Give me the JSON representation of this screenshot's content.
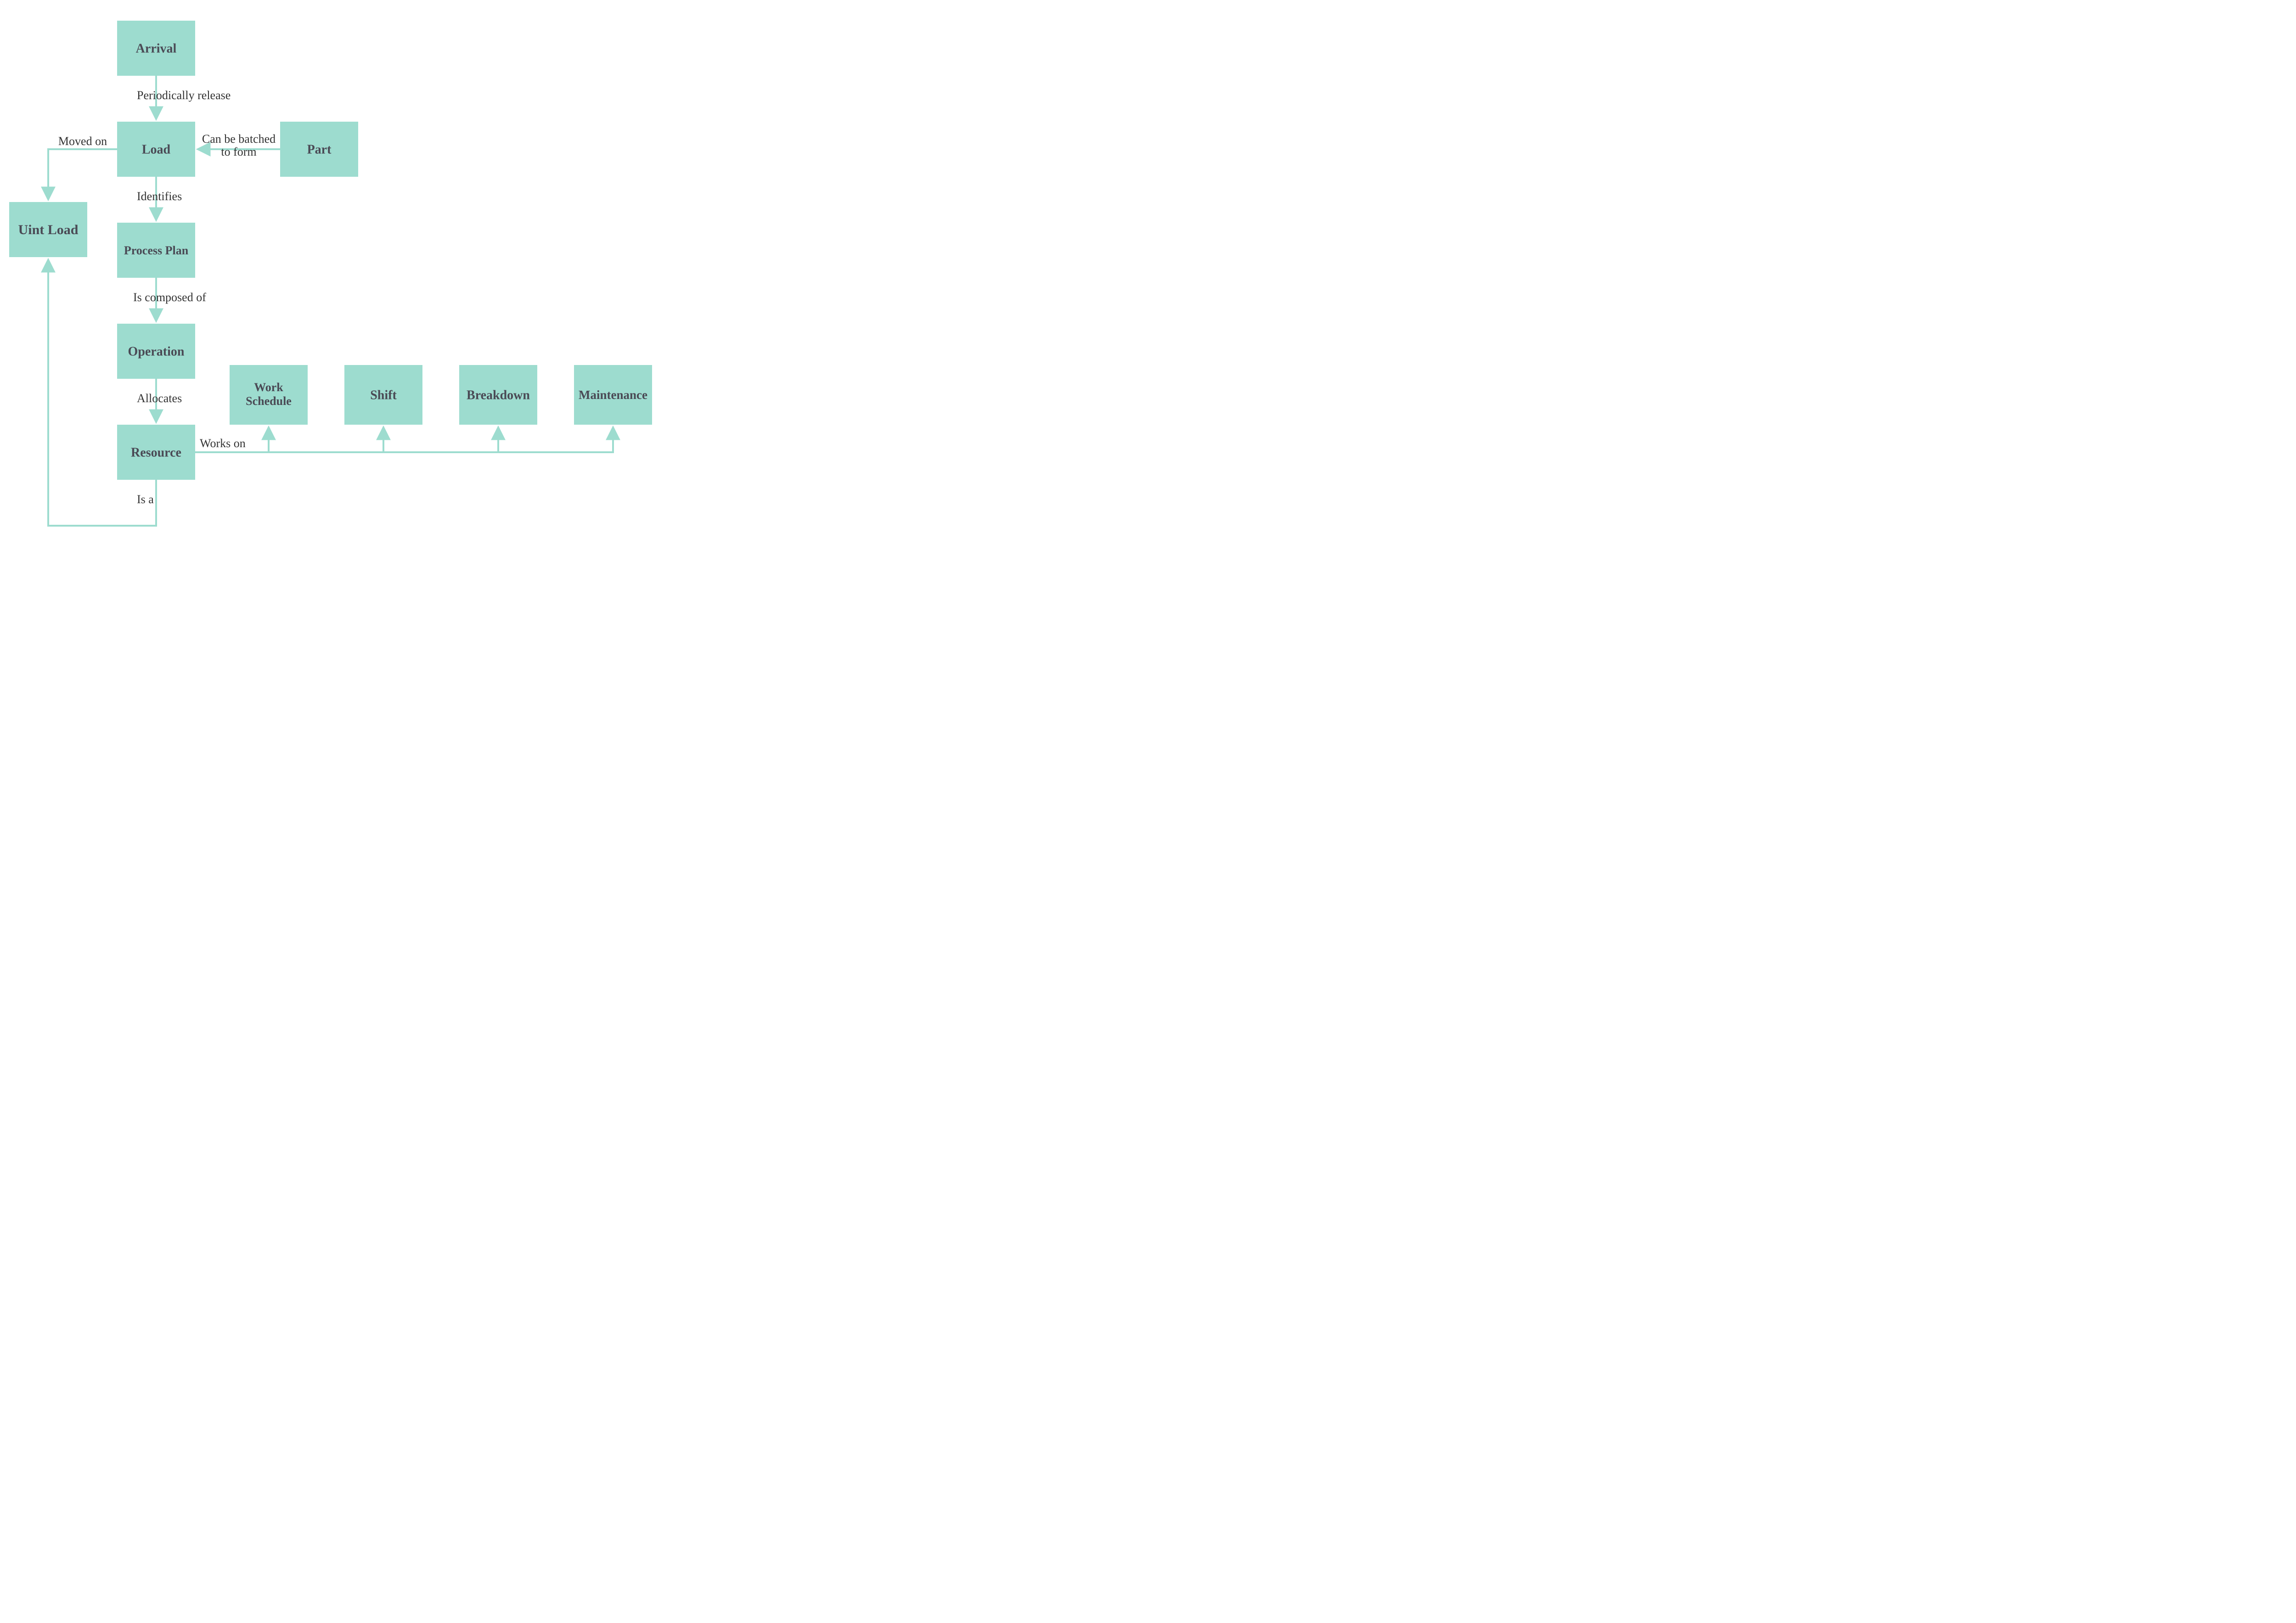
{
  "diagram": {
    "colors": {
      "node_fill": "#9ddccf",
      "node_text": "#4a4a55",
      "edge": "#9ddccf",
      "edge_text": "#333333"
    },
    "nodes": {
      "arrival": {
        "label": "Arrival"
      },
      "load": {
        "label": "Load"
      },
      "part": {
        "label": "Part"
      },
      "uint_load": {
        "label": "Uint Load"
      },
      "process_plan": {
        "label": "Process Plan"
      },
      "operation": {
        "label": "Operation"
      },
      "resource": {
        "label": "Resource"
      },
      "work_schedule": {
        "label_line1": "Work",
        "label_line2": "Schedule"
      },
      "shift": {
        "label": "Shift"
      },
      "breakdown": {
        "label": "Breakdown"
      },
      "maintenance": {
        "label": "Maintenance"
      }
    },
    "edges": {
      "arrival_to_load": {
        "label": "Periodically release"
      },
      "part_to_load": {
        "label_line1": "Can be batched",
        "label_line2": "to form"
      },
      "load_to_uintload": {
        "label": "Moved on"
      },
      "load_to_processplan": {
        "label": "Identifies"
      },
      "processplan_to_operation": {
        "label": "Is composed of"
      },
      "operation_to_resource": {
        "label": "Allocates"
      },
      "resource_to_row": {
        "label": "Works on"
      },
      "resource_to_uintload": {
        "label": "Is a"
      }
    }
  }
}
